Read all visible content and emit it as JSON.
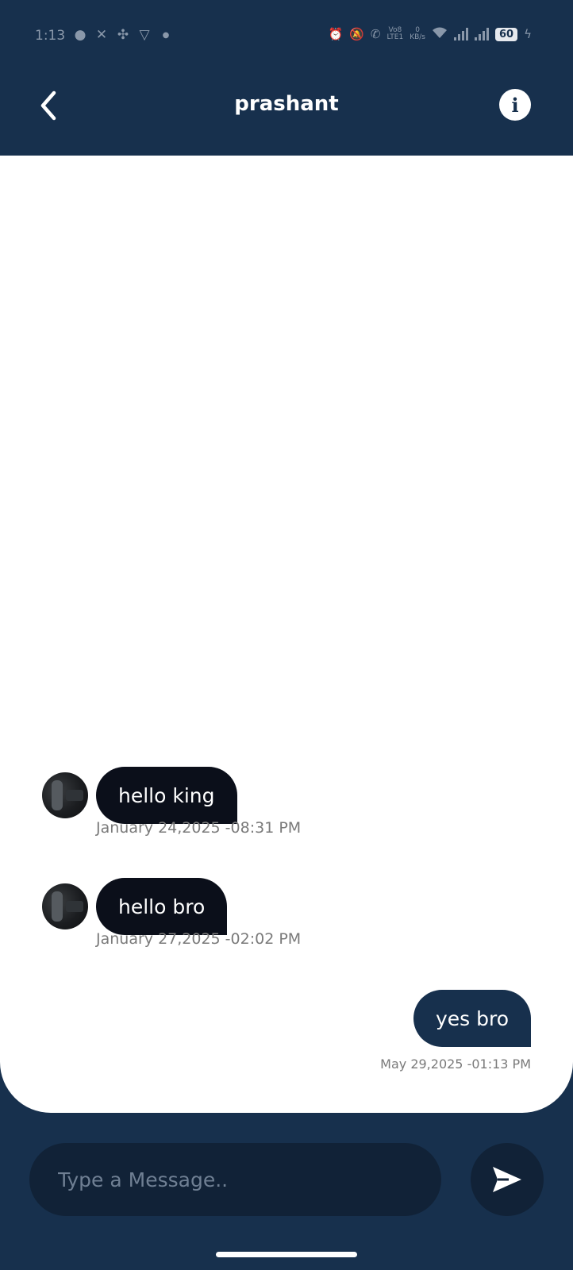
{
  "status_bar": {
    "time": "1:13",
    "left_icons": [
      "chat-bubble-icon",
      "x-logo-icon",
      "pinwheel-icon",
      "shield-app-icon",
      "dot-icon"
    ],
    "network_label_top": "Vo8",
    "network_label_bottom": "LTE1",
    "speed_value": "0",
    "speed_unit": "KB/s",
    "battery": "60"
  },
  "header": {
    "title": "prashant"
  },
  "messages": [
    {
      "direction": "incoming",
      "text": "hello king",
      "timestamp": "January 24,2025 -08:31 PM"
    },
    {
      "direction": "incoming",
      "text": "hello bro",
      "timestamp": "January 27,2025 -02:02 PM"
    },
    {
      "direction": "outgoing",
      "text": "yes bro",
      "timestamp": "May 29,2025 -01:13 PM"
    }
  ],
  "composer": {
    "placeholder": "Type a Message.."
  },
  "colors": {
    "primary": "#17304d",
    "incoming_bubble": "#0b0f1a",
    "input_bg": "#112237",
    "panel": "#ffffff"
  }
}
